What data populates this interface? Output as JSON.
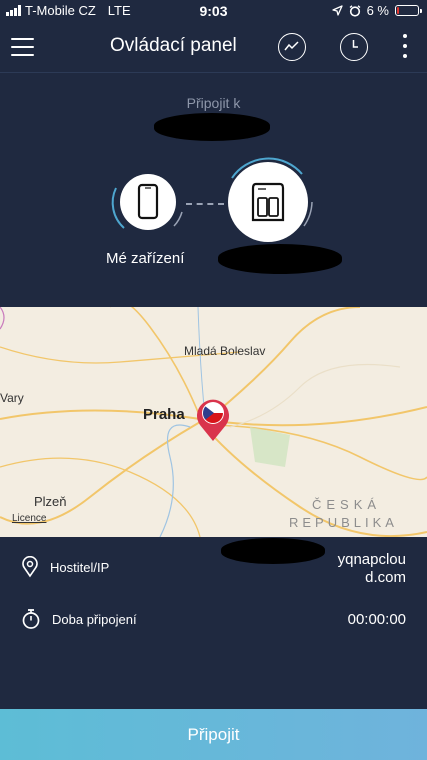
{
  "status_bar": {
    "carrier": "T-Mobile CZ",
    "network": "LTE",
    "time": "9:03",
    "battery_percent": "6 %",
    "battery_level": 0.06
  },
  "app_bar": {
    "title": "Ovládací panel",
    "icons": [
      "menu-icon",
      "chart-icon",
      "clock-icon",
      "more-icon"
    ]
  },
  "connection": {
    "connect_to_label": "Připojit k",
    "my_device_label": "Mé zařízení"
  },
  "map": {
    "labels": {
      "mlada_boleslav": "Mladá Boleslav",
      "vary": "Vary",
      "praha": "Praha",
      "plzen": "Plzeň",
      "ceska": "ČESKÁ",
      "republika": "REPUBLIKA",
      "licence": "Licence"
    },
    "colors": {
      "pin": "#d9344c",
      "flag_blue": "#2f3e8e",
      "flag_red": "#d7141a"
    }
  },
  "details": {
    "host_label": "Hostitel/IP",
    "host_value_line1": "yqnapclou",
    "host_value_line2": "d.com",
    "duration_label": "Doba připojení",
    "duration_value": "00:00:00"
  },
  "footer": {
    "connect_button_label": "Připojit"
  },
  "colors": {
    "background": "#1f2940",
    "button_gradient_start": "#5dbdd6",
    "button_gradient_end": "#6fb3dc",
    "arc": "#4ea6cf"
  }
}
